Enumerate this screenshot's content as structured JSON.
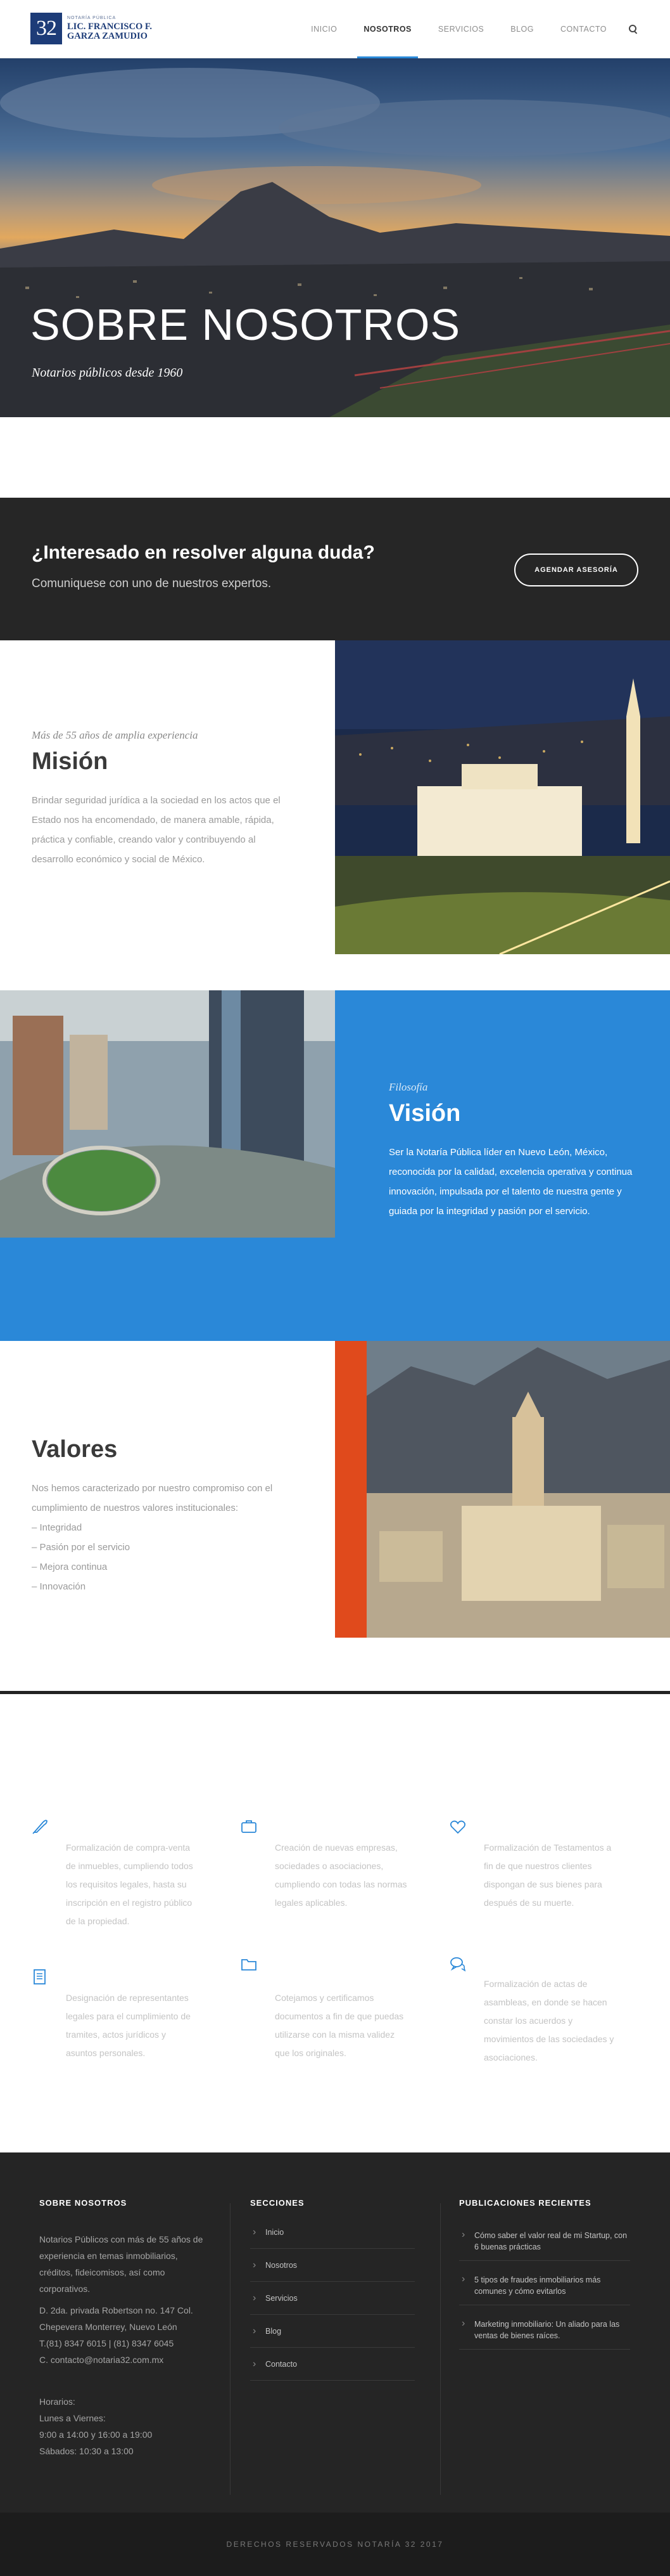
{
  "header": {
    "logo_number": "32",
    "logo_small": "NOTARÍA PÚBLICA",
    "logo_name_line1": "LIC. FRANCISCO F.",
    "logo_name_line2": "GARZA ZAMUDIO",
    "nav": [
      {
        "label": "INICIO",
        "active": false
      },
      {
        "label": "NOSOTROS",
        "active": true
      },
      {
        "label": "SERVICIOS",
        "active": false
      },
      {
        "label": "BLOG",
        "active": false
      },
      {
        "label": "CONTACTO",
        "active": false
      }
    ],
    "search_icon": "search-icon"
  },
  "hero": {
    "title": "SOBRE NOSOTROS",
    "subtitle": "Notarios públicos desde 1960"
  },
  "cta": {
    "title": "¿Interesado en resolver alguna duda?",
    "subtitle": "Comuniquese con uno de nuestros expertos.",
    "button": "AGENDAR ASESORÍA"
  },
  "mision": {
    "eyebrow": "Más de 55 años de amplia experiencia",
    "title": "Misión",
    "body": "Brindar seguridad jurídica a la sociedad en los actos que el Estado nos ha encomendado, de manera amable, rápida, práctica y confiable, creando valor y contribuyendo al desarrollo económico y social de México."
  },
  "vision": {
    "eyebrow": "Filosofía",
    "title": "Visión",
    "body": "Ser la Notaría Pública líder en Nuevo León, México, reconocida por la calidad, excelencia operativa y continua innovación, impulsada por el talento de nuestra gente y guiada por la integridad y pasión por el servicio.",
    "accent": "#2a88d8"
  },
  "valores": {
    "title": "Valores",
    "intro_1": "Nos hemos caracterizado por nuestro compromiso con el",
    "intro_2": "cumplimiento de nuestros valores institucionales:",
    "items": [
      "– Integridad",
      "– Pasión por el servicio",
      "– Mejora continua",
      "– Innovación"
    ]
  },
  "services": [
    {
      "icon": "quill-icon",
      "text": "Formalización de compra-venta de inmuebles, cumpliendo todos los requisitos legales, hasta su inscripción en el registro público de la propiedad."
    },
    {
      "icon": "briefcase-icon",
      "text": "Creación de nuevas empresas, sociedades o asociaciones, cumpliendo con todas las normas legales aplicables."
    },
    {
      "icon": "heart-icon",
      "text": "Formalización de Testamentos a fin de que nuestros clientes dispongan de sus bienes para después de su muerte."
    },
    {
      "icon": "document-icon",
      "text": "Designación de representantes legales para el cumplimiento de tramites, actos jurídicos y asuntos personales."
    },
    {
      "icon": "folder-icon",
      "text": "Cotejamos y certificamos documentos a fin de que puedas utilizarse con la misma validez que los originales."
    },
    {
      "icon": "chat-icon",
      "text": "Formalización de actas de asambleas, en donde se hacen constar los acuerdos y movimientos de las sociedades y asociaciones."
    }
  ],
  "footer": {
    "about_title": "SOBRE NOSOTROS",
    "about_text": "Notarios Públicos con más de 55 años de experiencia en temas inmobiliarios, créditos, fideicomisos, así como corporativos.",
    "address_1": "D. 2da. privada Robertson no. 147 Col.",
    "address_2": "Chepevera Monterrey, Nuevo León",
    "phone": "T.(81) 8347 6015 | (81) 8347 6045",
    "email": "C. contacto@notaria32.com.mx",
    "hours_title": "Horarios:",
    "hours_1": "Lunes a Viernes:",
    "hours_2": "9:00 a 14:00 y 16:00 a 19:00",
    "hours_3": "Sábados: 10:30 a 13:00",
    "sections_title": "SECCIONES",
    "sections": [
      "Inicio",
      "Nosotros",
      "Servicios",
      "Blog",
      "Contacto"
    ],
    "posts_title": "PUBLICACIONES RECIENTES",
    "posts": [
      "Cómo saber el valor real de mi Startup, con 6 buenas prácticas",
      "5 tipos de fraudes inmobiliarios más comunes y cómo evitarlos",
      "Marketing inmobiliario: Un aliado para las ventas de bienes raíces."
    ]
  },
  "copyright": "DERECHOS RESERVADOS NOTARÍA 32 2017"
}
